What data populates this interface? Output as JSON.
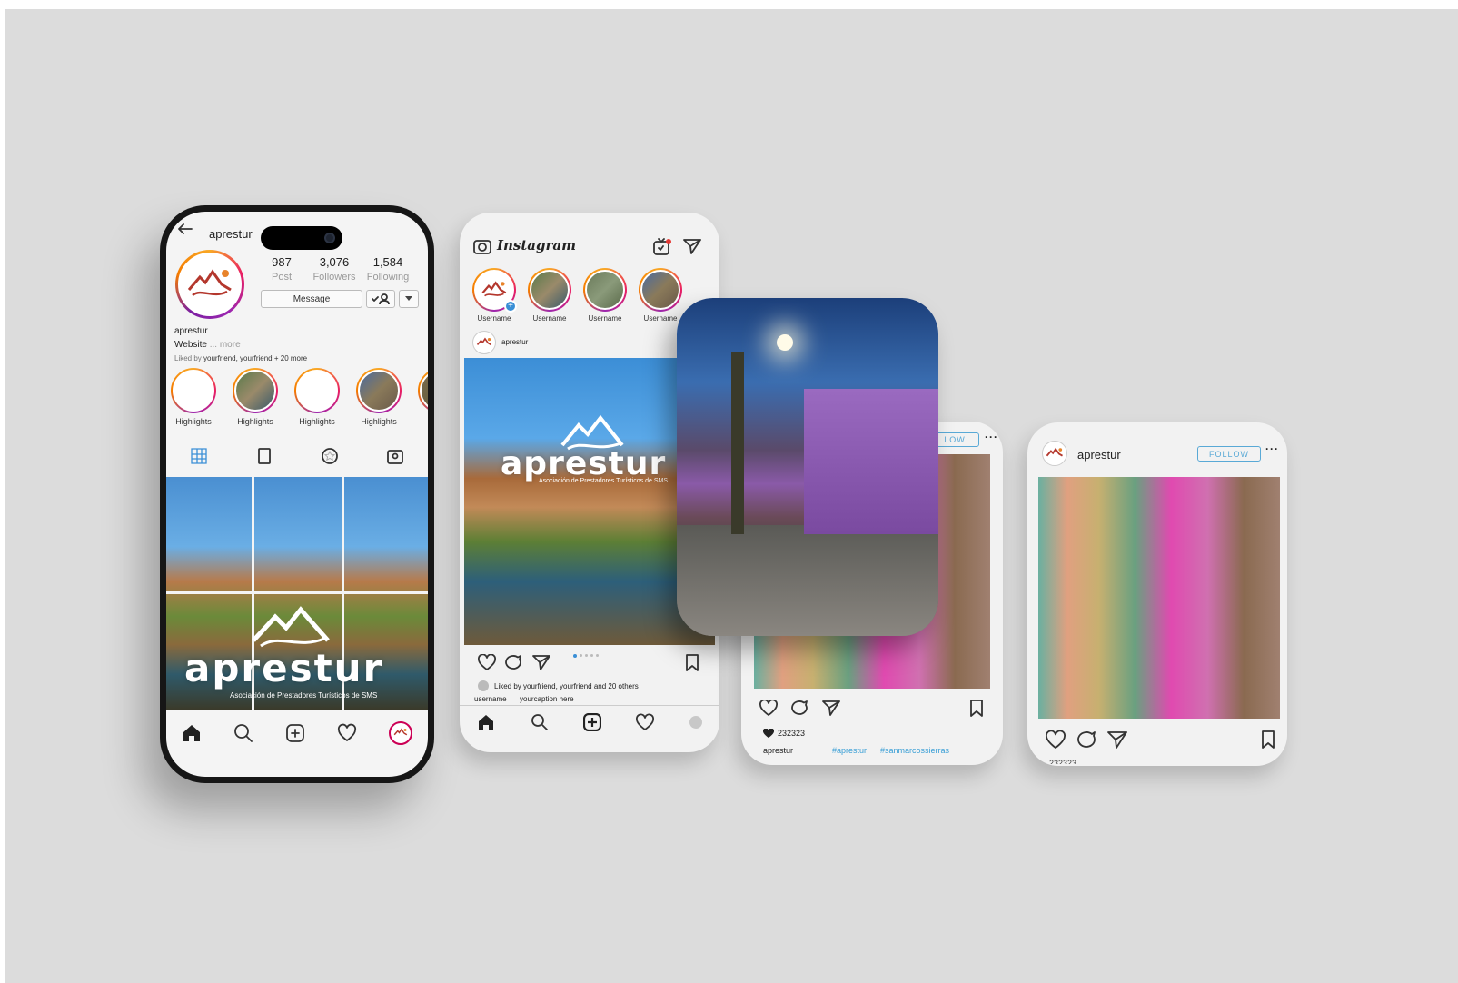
{
  "profile_phone": {
    "username": "aprestur",
    "stats": [
      {
        "value": "987",
        "label": "Post"
      },
      {
        "value": "3,076",
        "label": "Followers"
      },
      {
        "value": "1,584",
        "label": "Following"
      }
    ],
    "message_button": "Message",
    "bio_name": "aprestur",
    "bio_website": "Website",
    "bio_more": "... more",
    "liked_prefix": "Liked by",
    "liked_names": "yourfriend, yourfriend",
    "liked_suffix": "+ 20 more",
    "highlights": [
      "Highlights",
      "Highlights",
      "Highlights",
      "Highlights",
      "Hi"
    ],
    "grid_logo": "aprestur",
    "grid_logo_sub": "Asociación de Prestadores Turísticos de SMS"
  },
  "feed_phone": {
    "app_name": "Instagram",
    "stories": [
      "Username",
      "Username",
      "Username",
      "Username"
    ],
    "post_user": "aprestur",
    "post_logo": "aprestur",
    "post_logo_sub": "Asociación de Prestadores Turísticos de SMS",
    "liked_text": "Liked by yourfriend, yourfriend and 20 others",
    "caption_user": "username",
    "caption_text": "yourcaption here"
  },
  "post_card_3": {
    "follow_label": "LOW",
    "likes": "232323",
    "caption_user": "aprestur",
    "hashtags": [
      "#aprestur",
      "#sanmarcossierras"
    ]
  },
  "post_card_4": {
    "username": "aprestur",
    "follow_label": "FOLLOW",
    "likes": "232323"
  },
  "colors": {
    "background": "#dcdcdc",
    "accent_blue": "#3a9fd6",
    "brand_red": "#b4372d"
  }
}
